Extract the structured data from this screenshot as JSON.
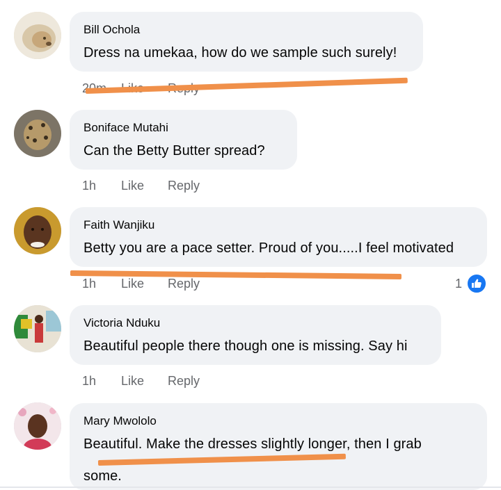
{
  "comments": [
    {
      "author": "Bill Ochola",
      "text": "Dress na umekaa, how do we sample such surely!",
      "time": "20m",
      "like": "Like",
      "reply": "Reply"
    },
    {
      "author": "Boniface Mutahi",
      "text": "Can the Betty Butter  spread?",
      "time": "1h",
      "like": "Like",
      "reply": "Reply"
    },
    {
      "author": "Faith Wanjiku",
      "text": "Betty you are a pace setter. Proud of you.....I feel motivated",
      "time": "1h",
      "like": "Like",
      "reply": "Reply",
      "reaction_count": "1",
      "reaction_icon": "like-thumb-icon"
    },
    {
      "author": "Victoria Nduku",
      "text": "Beautiful people there though one is missing. Say hi",
      "time": "1h",
      "like": "Like",
      "reply": "Reply"
    },
    {
      "author": "Mary Mwololo",
      "text_line1": "Beautiful. Make the dresses slightly longer, then I grab",
      "text_line2": "some."
    }
  ],
  "colors": {
    "bubble": "#f0f2f5",
    "meta_text": "#65676b",
    "annotation_stroke": "#f0904a",
    "like_blue": "#1877f2"
  }
}
